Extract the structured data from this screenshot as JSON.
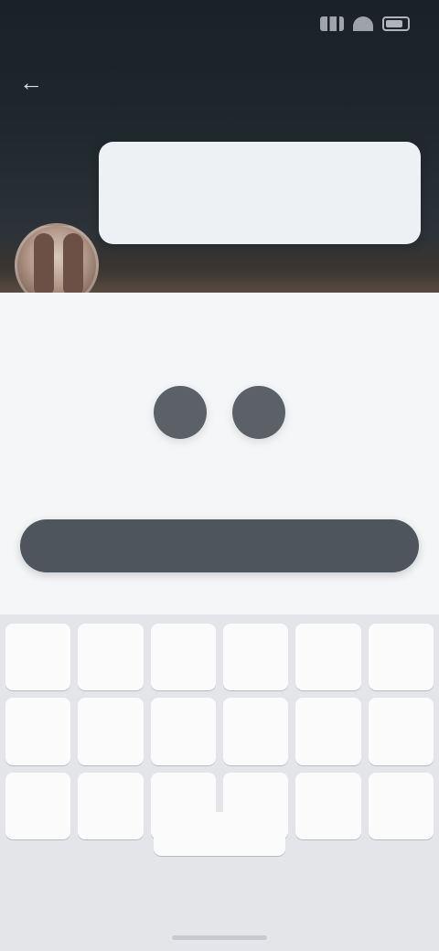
{
  "status_bar": {
    "time": "",
    "icons": [
      "signal-icon",
      "wifi-icon",
      "battery-icon"
    ]
  },
  "header": {
    "title": "",
    "back_icon": "back-arrow-icon"
  },
  "prompt": {
    "text": ""
  },
  "avatar": {
    "icon": "avatar-image"
  },
  "exercise": {
    "word": "",
    "slot_count": 2
  },
  "actions": {
    "check_label": ""
  },
  "keyboard": {
    "rows": [
      [
        "",
        "",
        "",
        "",
        "",
        ""
      ],
      [
        "",
        "",
        "",
        "",
        "",
        ""
      ],
      [
        "",
        "",
        "",
        "",
        "",
        ""
      ]
    ],
    "left_label": "",
    "space_label": "",
    "right_label": ""
  },
  "colors": {
    "header_bg": "#1f282e",
    "bubble_bg": "#eef1f3",
    "content_bg": "#f5f6f8",
    "slot": "#5b6167",
    "button_bg": "#4e555c",
    "keyboard_bg": "#e3e5e9"
  }
}
